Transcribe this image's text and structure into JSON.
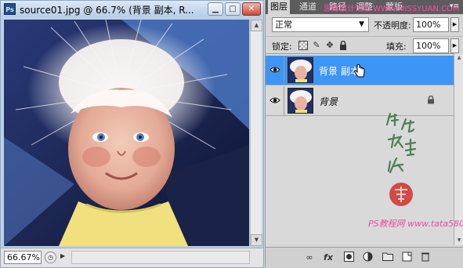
{
  "document": {
    "title": "source01.jpg @ 66.7% (背景 副本, R...",
    "app_icon": "PS-icon",
    "zoom": "66.67%",
    "window_buttons": {
      "minimize": "minimize-icon",
      "maximize": "maximize-icon",
      "close": "close-icon"
    }
  },
  "layers_panel": {
    "tabs": [
      "图层",
      "通道",
      "路径",
      "调整",
      "蒙版"
    ],
    "active_tab": "图层",
    "watermark_top": "思缘设计论坛 WWW.MISSYUAN.COM",
    "blend_mode": "正常",
    "opacity_label": "不透明度:",
    "opacity": "100%",
    "lock_label": "锁定:",
    "fill_label": "填充:",
    "fill": "100%",
    "layers": [
      {
        "name": "背景 副本",
        "selected": true,
        "visible": true
      },
      {
        "name": "背景",
        "selected": false,
        "visible": true,
        "locked": true
      }
    ],
    "signature_text": "他她我帮你",
    "watermark_bottom": "PS教程网 www.tata580.com",
    "bottom_buttons": [
      "link-icon",
      "fx-icon",
      "mask-icon",
      "adjustment-icon",
      "group-icon",
      "new-layer-icon",
      "trash-icon"
    ]
  },
  "colors": {
    "selection": "#3d96f5",
    "panel_bg": "#d6d6d6",
    "titlebar": "#c9d9ec",
    "watermark": "#e2529a"
  }
}
